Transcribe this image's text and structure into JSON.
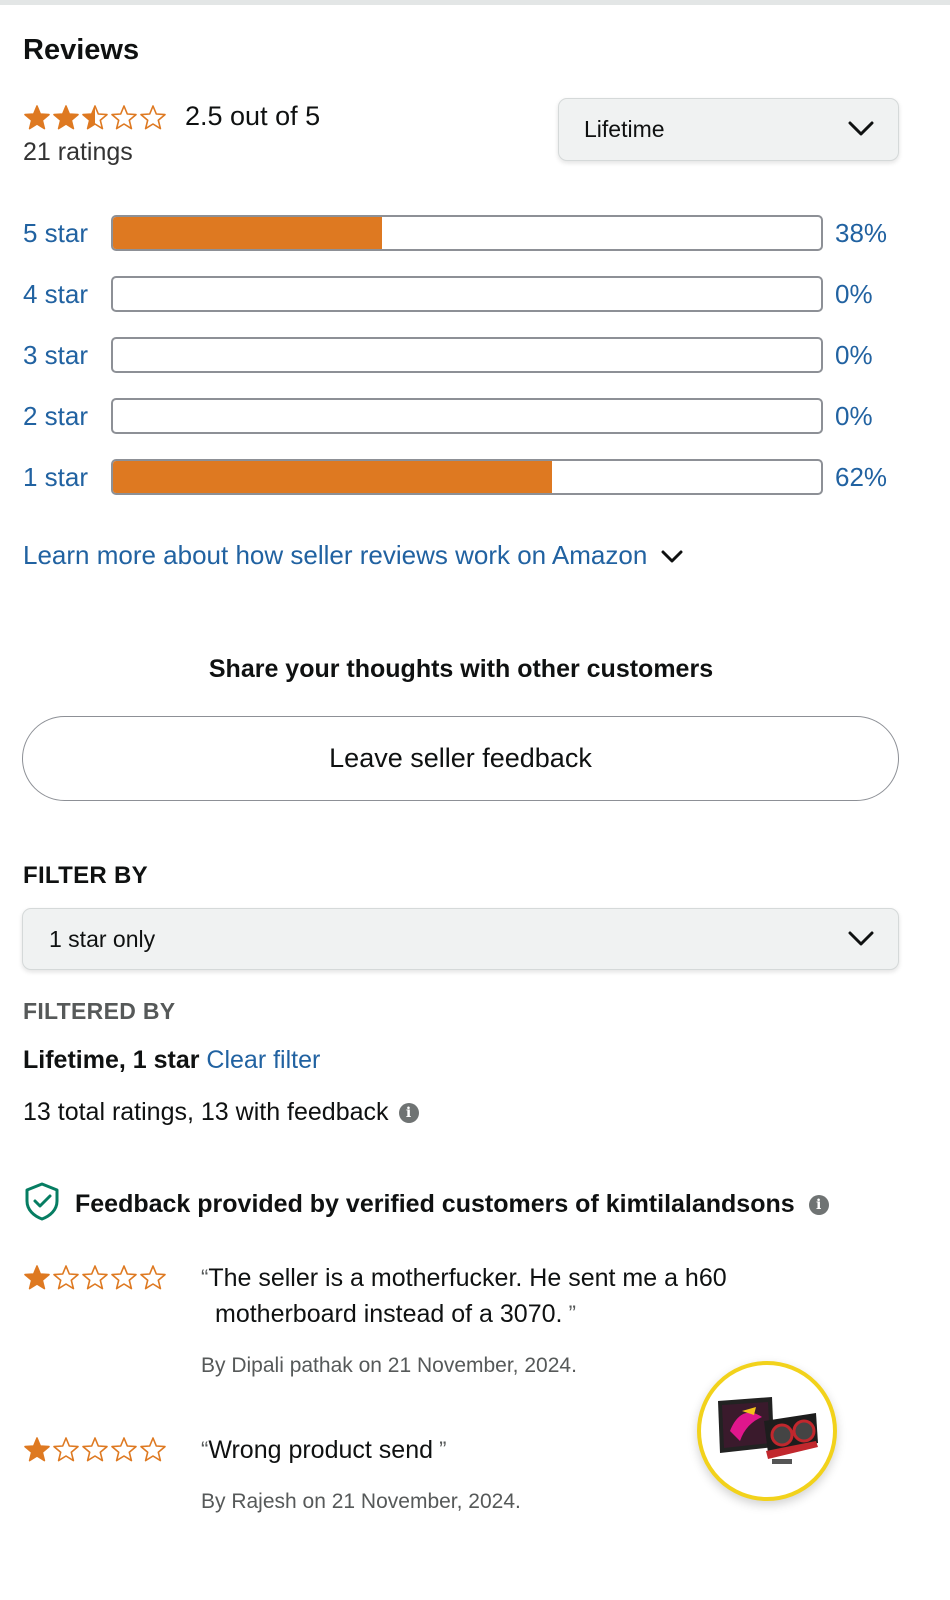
{
  "page": {
    "title": "Reviews"
  },
  "summary": {
    "rating": 2.5,
    "rating_text": "2.5 out of  5",
    "ratings_count": "21 ratings",
    "period_select": "Lifetime"
  },
  "histogram": [
    {
      "label": "5 star",
      "percent_text": "38%",
      "percent": 38
    },
    {
      "label": "4 star",
      "percent_text": "0%",
      "percent": 0
    },
    {
      "label": "3 star",
      "percent_text": "0%",
      "percent": 0
    },
    {
      "label": "2 star",
      "percent_text": "0%",
      "percent": 0
    },
    {
      "label": "1 star",
      "percent_text": "62%",
      "percent": 62
    }
  ],
  "learn_more": "Learn more about how seller reviews work on Amazon",
  "share": {
    "heading": "Share your thoughts with other customers",
    "button": "Leave seller feedback"
  },
  "filter": {
    "label": "FILTER BY",
    "selected": "1 star only",
    "filtered_by_label": "FILTERED BY",
    "filtered_by_value": "Lifetime, 1 star",
    "clear": "Clear filter",
    "totals": "13 total ratings, 13 with feedback"
  },
  "verified": {
    "text": "Feedback provided by verified customers of kimtilalandsons"
  },
  "reviews": [
    {
      "rating": 1,
      "line1": "The seller is a motherfucker. He sent me a h60",
      "line2": "motherboard instead of a 3070.",
      "byline": "By Dipali pathak on 21 November, 2024."
    },
    {
      "rating": 1,
      "line1": "Wrong product send",
      "byline": "By Rajesh on 21 November, 2024."
    }
  ],
  "colors": {
    "accent_orange": "#de7921",
    "link_blue": "#2162a1",
    "verified_green": "#067d62",
    "badge_yellow": "#f2d21b"
  },
  "icons": {
    "dropdown": "chevron-down-icon",
    "info": "info-icon",
    "verified": "shield-check-icon",
    "star": "star-icon",
    "product": "graphics-card-thumbnail"
  }
}
